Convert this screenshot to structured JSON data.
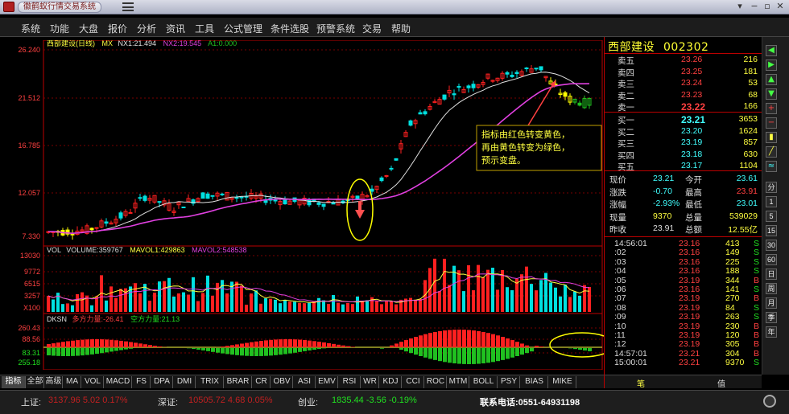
{
  "window": {
    "title": "徽鹤蚁行情交易系统"
  },
  "menu": [
    "系统",
    "功能",
    "大盘",
    "报价",
    "分析",
    "资讯",
    "工具",
    "公式管理",
    "条件选股",
    "预警系统",
    "交易",
    "帮助"
  ],
  "chart": {
    "legend": {
      "name": "西部建设(日线)",
      "mx": "MX",
      "nx1": "NX1:21.494",
      "nx2": "NX2:19.545",
      "a1": "A1:0.000"
    },
    "price_axis": [
      "26.240",
      "21.512",
      "16.785",
      "12.057",
      "7.330"
    ],
    "volume_legend": {
      "vol": "VOL",
      "volume": "VOLUME:359767",
      "mavol1": "MAVOL1:429863",
      "mavol2": "MAVOL2:548538"
    },
    "volume_axis": [
      "13030",
      "9772",
      "6515",
      "3257"
    ],
    "volume_unit": "X100",
    "dksn_legend": {
      "name": "DKSN",
      "duo": "多方力量:-26.41",
      "kong": "空方力量:21.13"
    },
    "dksn_axis": [
      "260.43",
      "88.56",
      "83.31",
      "255.18"
    ],
    "date_axis": [
      "2016年",
      "2017年",
      "01月",
      "20日",
      "26日",
      "02月",
      "14日",
      "20日",
      "24日",
      "03月",
      "08日",
      "14日",
      "20日",
      "24日",
      "30日",
      "05日",
      "13日",
      "19日",
      "25日",
      "05月",
      "08日",
      "12E"
    ],
    "annotation": "指标由红色转变黄色，\n再由黄色转变为绿色，\n预示变盘。",
    "colors": {
      "up": "#ff2020",
      "down": "#00e0e0",
      "ma1": "#e0e0e0",
      "ma2": "#e040e0",
      "yellow": "#ffff00",
      "green": "#20c020"
    }
  },
  "quote": {
    "name": "西部建设",
    "code": "002302",
    "asks": [
      {
        "label": "卖五",
        "price": "23.26",
        "vol": "216"
      },
      {
        "label": "卖四",
        "price": "23.25",
        "vol": "181"
      },
      {
        "label": "卖三",
        "price": "23.24",
        "vol": "53"
      },
      {
        "label": "卖二",
        "price": "23.23",
        "vol": "68"
      },
      {
        "label": "卖一",
        "price": "23.22",
        "vol": "166"
      }
    ],
    "bids": [
      {
        "label": "买一",
        "price": "23.21",
        "vol": "3653"
      },
      {
        "label": "买二",
        "price": "23.20",
        "vol": "1624"
      },
      {
        "label": "买三",
        "price": "23.19",
        "vol": "857"
      },
      {
        "label": "买四",
        "price": "23.18",
        "vol": "630"
      },
      {
        "label": "买五",
        "price": "23.17",
        "vol": "1104"
      }
    ],
    "stats": [
      {
        "l1": "现价",
        "v1": "23.21",
        "l2": "今开",
        "v2": "23.61"
      },
      {
        "l1": "涨跌",
        "v1": "-0.70",
        "l2": "最高",
        "v2": "23.91"
      },
      {
        "l1": "涨幅",
        "v1": "-2.93%",
        "l2": "最低",
        "v2": "23.01"
      },
      {
        "l1": "现量",
        "v1": "9370",
        "l2": "总量",
        "v2": "539029"
      },
      {
        "l1": "昨收",
        "v1": "23.91",
        "l2": "总额",
        "v2": "12.55亿"
      }
    ],
    "ticks": [
      {
        "t": "14:56:01",
        "p": "23.16",
        "v": "413",
        "s": "S"
      },
      {
        "t": ":02",
        "p": "23.16",
        "v": "149",
        "s": "S"
      },
      {
        "t": ":03",
        "p": "23.16",
        "v": "225",
        "s": "S"
      },
      {
        "t": ":04",
        "p": "23.16",
        "v": "188",
        "s": "S"
      },
      {
        "t": ":05",
        "p": "23.19",
        "v": "344",
        "s": "B"
      },
      {
        "t": ":06",
        "p": "23.16",
        "v": "141",
        "s": "S"
      },
      {
        "t": ":07",
        "p": "23.19",
        "v": "270",
        "s": "B"
      },
      {
        "t": ":08",
        "p": "23.19",
        "v": "84",
        "s": "S"
      },
      {
        "t": ":09",
        "p": "23.19",
        "v": "263",
        "s": "S"
      },
      {
        "t": ":10",
        "p": "23.19",
        "v": "230",
        "s": "B"
      },
      {
        "t": ":11",
        "p": "23.19",
        "v": "120",
        "s": "B"
      },
      {
        "t": ":12",
        "p": "23.19",
        "v": "305",
        "s": "B"
      },
      {
        "t": "14:57:01",
        "p": "23.21",
        "v": "304",
        "s": "B"
      },
      {
        "t": "15:00:01",
        "p": "23.21",
        "v": "9370",
        "s": "S"
      }
    ],
    "tabs": [
      "笔",
      "值"
    ]
  },
  "toolbar": [
    "分",
    "1",
    "5",
    "15",
    "30",
    "60",
    "日",
    "周",
    "月",
    "季",
    "年"
  ],
  "bottom_tabs": [
    "指标",
    "全部",
    "高级",
    "MA",
    "VOL",
    "MACD",
    "FS",
    "DPA",
    "DMI",
    "TRIX",
    "BRAR",
    "CR",
    "OBV",
    "ASI",
    "EMV",
    "RSI",
    "WR",
    "KDJ",
    "CCI",
    "ROC",
    "MTM",
    "BOLL",
    "PSY",
    "BIAS",
    "MIKE"
  ],
  "status": {
    "sh_label": "上证:",
    "sh_value": "3137.96  5.02  0.17%",
    "sz_label": "深证:",
    "sz_value": "10505.72  4.68  0.05%",
    "cy_label": "创业:",
    "cy_value": "1835.44  -3.56  -0.19%",
    "phone": "联系电话:0551-64931198"
  }
}
